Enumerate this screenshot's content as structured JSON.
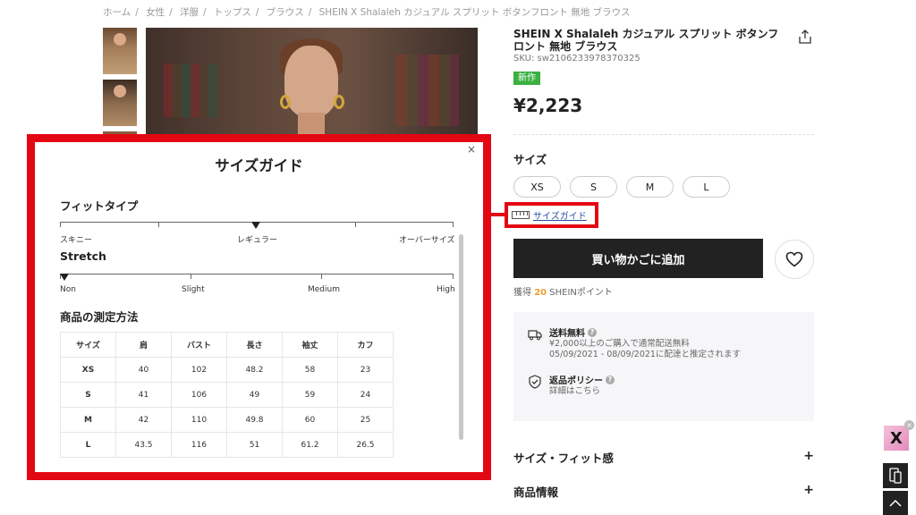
{
  "breadcrumb": [
    "ホーム",
    "女性",
    "洋服",
    "トップス",
    "ブラウス",
    "SHEIN X Shalaleh カジュアル スプリット ボタンフロント 無地 ブラウス"
  ],
  "product": {
    "title": "SHEIN X Shalaleh カジュアル スプリット ボタンフロント 無地 ブラウス",
    "sku": "SKU: sw2106233978370325",
    "badge": "新作",
    "price": "¥2,223",
    "size_label": "サイズ",
    "sizes": [
      "XS",
      "S",
      "M",
      "L"
    ],
    "size_guide_link": "サイズガイド",
    "add_to_cart": "買い物かごに追加",
    "points_prefix": "獲得",
    "points_value": "20",
    "points_suffix": "SHEINポイント"
  },
  "shipping": {
    "title": "送料無料",
    "line1": "¥2,000以上のご購入で通常配送無料",
    "line2": "05/09/2021 - 08/09/2021に配達と推定されます",
    "return_title": "返品ポリシー",
    "return_text": "詳細はこちら"
  },
  "accordions": [
    "サイズ・フィット感",
    "商品情報"
  ],
  "modal": {
    "close": "×",
    "title": "サイズガイド",
    "fit_title": "フィットタイプ",
    "fit_labels": [
      "スキニー",
      "レギュラー",
      "オーバーサイズ"
    ],
    "stretch_title": "Stretch",
    "stretch_labels": [
      "Non",
      "Slight",
      "Medium",
      "High"
    ],
    "measure_title": "商品の測定方法",
    "table": {
      "headers": [
        "サイズ",
        "肩",
        "バスト",
        "長さ",
        "袖丈",
        "カフ"
      ],
      "rows": [
        [
          "XS",
          "40",
          "102",
          "48.2",
          "58",
          "23"
        ],
        [
          "S",
          "41",
          "106",
          "49",
          "59",
          "24"
        ],
        [
          "M",
          "42",
          "110",
          "49.8",
          "60",
          "25"
        ],
        [
          "L",
          "43.5",
          "116",
          "51",
          "61.2",
          "26.5"
        ]
      ]
    }
  },
  "widgets": {
    "promo_letter": "X",
    "promo_close": "×"
  },
  "colors": {
    "highlight": "#e30613",
    "new_badge": "#3cb043",
    "points": "#f09c2b",
    "link": "#2a4ea5"
  }
}
